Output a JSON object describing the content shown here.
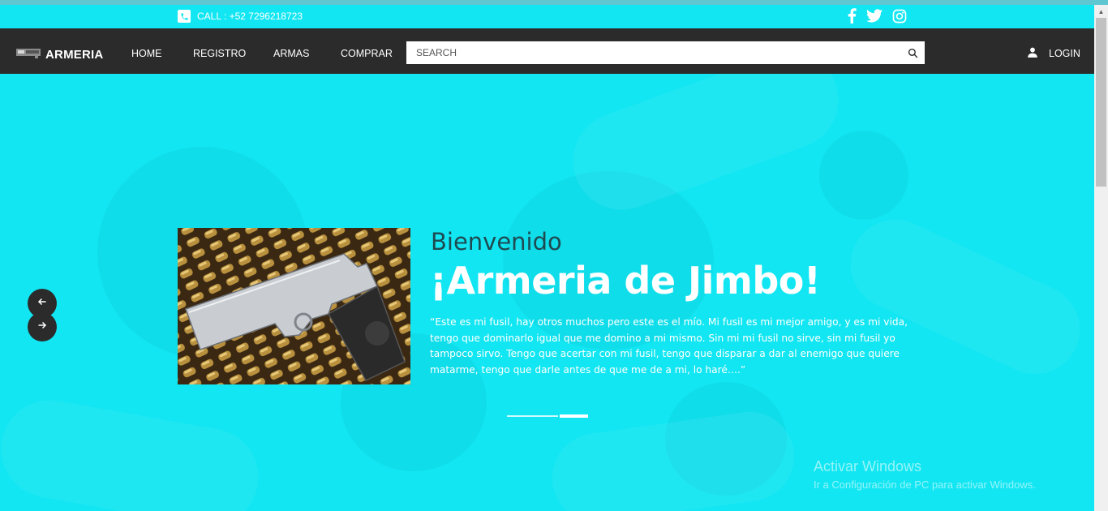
{
  "topbar": {
    "call_text": "CALL : +52 7296218723",
    "social_icons": [
      "facebook-icon",
      "twitter-icon",
      "instagram-icon"
    ]
  },
  "navbar": {
    "brand": "ARMERIA",
    "links": [
      "HOME",
      "REGISTRO",
      "ARMAS",
      "COMPRAR"
    ],
    "search_placeholder": "SEARCH",
    "login": "LOGIN"
  },
  "hero": {
    "welcome": "Bienvenido",
    "headline": "¡Armeria de Jimbo!",
    "quote": "“Este es mi fusil, hay otros muchos pero este es el mío. Mi fusil es mi mejor amigo, y es mi vida, tengo que dominarlo igual que me domino a mi mismo. Sin mi mi fusil no sirve, sin mi fusil yo tampoco sirvo. Tengo que acertar con mi fusil, tengo que disparar a dar al enemigo que quiere matarme, tengo que darle antes de que me de a mi, lo haré….”",
    "carousel_slides": 2,
    "active_slide": 2
  },
  "watermark": {
    "title": "Activar Windows",
    "subtitle": "Ir a Configuración de PC para activar Windows."
  },
  "colors": {
    "accent": "#12e6f2",
    "navbar": "#2b2b2b",
    "text_dark": "#1e4a52"
  }
}
